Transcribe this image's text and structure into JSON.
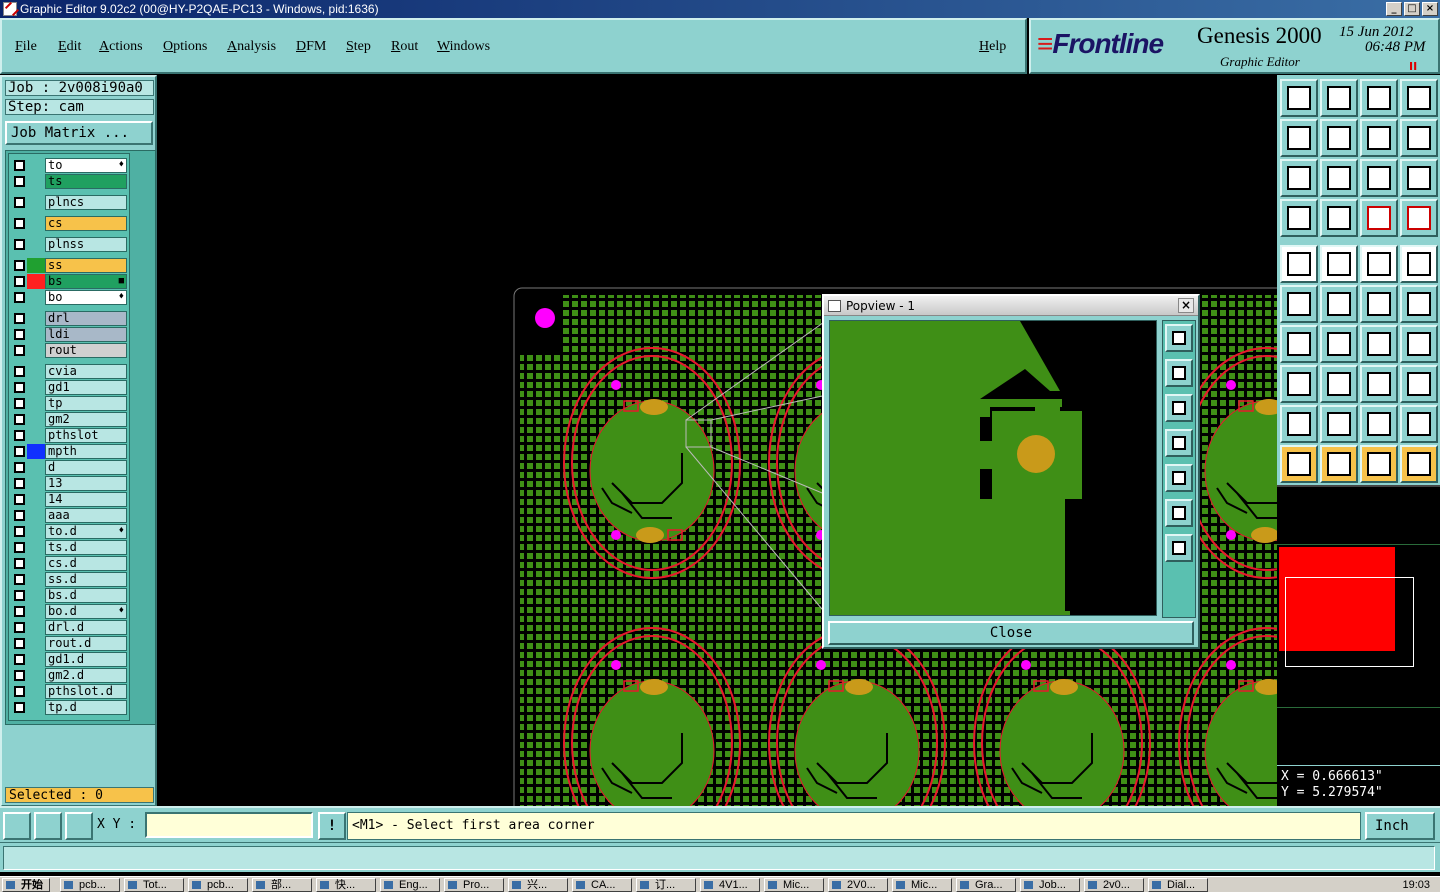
{
  "window": {
    "title": "Graphic Editor 9.02c2 (00@HY-P2QAE-PC13 - Windows, pid:1636)",
    "controls": [
      "_",
      "□",
      "×"
    ]
  },
  "menubar": {
    "items": [
      "File",
      "Edit",
      "Actions",
      "Options",
      "Analysis",
      "DFM",
      "Step",
      "Rout",
      "Windows"
    ],
    "help": "Help"
  },
  "brand": {
    "logo_prefix": "≡",
    "logo": "Frontline",
    "product": "Genesis 2000",
    "subtitle": "Graphic Editor",
    "date": "15 Jun 2012",
    "time": "06:48 PM",
    "pause": "II"
  },
  "job": {
    "job_label": "Job : 2v008i90a0",
    "step_label": "Step: cam",
    "matrix_button": "Job Matrix ..."
  },
  "layers": [
    {
      "name": "to",
      "style": "act",
      "mark": "♦"
    },
    {
      "name": "ts",
      "style": "ts"
    },
    {
      "name": "plncs",
      "style": ""
    },
    {
      "name": "cs",
      "style": "cs"
    },
    {
      "name": "plnss",
      "style": ""
    },
    {
      "name": "ss",
      "style": "ss",
      "color": "#20a030"
    },
    {
      "name": "bs",
      "style": "bs",
      "color": "#ff2020",
      "mark": "■"
    },
    {
      "name": "bo",
      "style": "act",
      "mark": "♦"
    },
    {
      "name": "drl",
      "style": "grey"
    },
    {
      "name": "ldi",
      "style": "grey"
    },
    {
      "name": "rout",
      "style": "lg"
    },
    {
      "name": "cvia",
      "style": ""
    },
    {
      "name": "gd1",
      "style": ""
    },
    {
      "name": "tp",
      "style": ""
    },
    {
      "name": "gm2",
      "style": ""
    },
    {
      "name": "pthslot",
      "style": ""
    },
    {
      "name": "mpth",
      "style": "",
      "color": "#1030ff"
    },
    {
      "name": "d",
      "style": ""
    },
    {
      "name": "13",
      "style": ""
    },
    {
      "name": "14",
      "style": ""
    },
    {
      "name": "aaa",
      "style": ""
    },
    {
      "name": "to.d",
      "style": "",
      "mark": "♦"
    },
    {
      "name": "ts.d",
      "style": ""
    },
    {
      "name": "cs.d",
      "style": ""
    },
    {
      "name": "ss.d",
      "style": ""
    },
    {
      "name": "bs.d",
      "style": ""
    },
    {
      "name": "bo.d",
      "style": "",
      "mark": "♦"
    },
    {
      "name": "drl.d",
      "style": ""
    },
    {
      "name": "rout.d",
      "style": ""
    },
    {
      "name": "gd1.d",
      "style": ""
    },
    {
      "name": "gm2.d",
      "style": ""
    },
    {
      "name": "pthslot.d",
      "style": ""
    },
    {
      "name": "tp.d",
      "style": ""
    }
  ],
  "selected": "Selected : 0",
  "popview": {
    "title": "Popview - 1",
    "close": "Close",
    "close_icon": "×"
  },
  "coords": {
    "x": "X = 0.666613\"",
    "y": "Y = 5.279574\""
  },
  "status": {
    "xy_label": "X Y :",
    "xy_value": "",
    "prompt_icon": "!",
    "prompt": "<M1> - Select first area corner",
    "unit": "Inch"
  },
  "taskbar": {
    "start": "开始",
    "tasks": [
      "pcb...",
      "Tot...",
      "pcb...",
      "部...",
      "快...",
      "Eng...",
      "Pro...",
      "兴...",
      "CA...",
      "订...",
      "4V1...",
      "Mic...",
      "2V0...",
      "Mic...",
      "Gra...",
      "Job...",
      "2v0...",
      "Dial..."
    ],
    "clock": "19:03"
  },
  "colors": {
    "panel": "#8ed2cf",
    "copper": "#3f8f16",
    "outline": "#e8192c",
    "pad": "#c99a1a",
    "marker": "#ff00ff"
  }
}
